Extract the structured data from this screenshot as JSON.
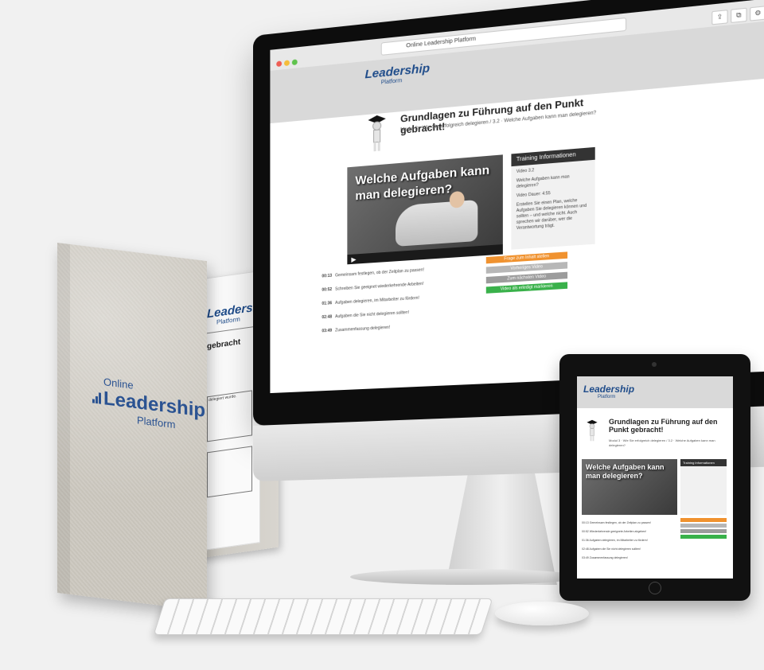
{
  "brand": {
    "line1": "Online",
    "line2": "Leadership",
    "line3": "Platform"
  },
  "folder": {
    "sheet_brand": "Leadership",
    "sheet_sub": "Platform",
    "sheet_title": "gebracht",
    "sheet_small": "delegiert wurde."
  },
  "browser": {
    "address": "Online Leadership Platform",
    "buttons": [
      "⇪",
      "⧉",
      "⚙"
    ]
  },
  "site": {
    "logo": "Leadership",
    "logo_sub": "Platform",
    "course_title": "Grundlagen zu Führung auf den Punkt gebracht!",
    "breadcrumb": "Modul 3  ·  Wie Sie erfolgreich delegieren  /  3.2  ·  Welche Aufgaben kann man delegieren?",
    "video_title": "Welche Aufgaben kann man delegieren?",
    "training_header": "Training Informationen",
    "training_lines": [
      "Video 3.2",
      "Welche Aufgaben kann man delegieren?",
      "Video Dauer: 4:55",
      "Erstellen Sie einen Plan, welche Aufgaben Sie delegieren können und sollten – und welche nicht. Auch sprechen wir darüber, wer die Verantwortung trägt."
    ],
    "buttons": [
      {
        "label": "Frage zum Inhalt stellen",
        "color": "#f0922f"
      },
      {
        "label": "Vorheriges Video",
        "color": "#b7b7b7"
      },
      {
        "label": "Zum nächsten Video",
        "color": "#9c9c9c"
      },
      {
        "label": "Video als erledigt markieren",
        "color": "#39b14a"
      }
    ],
    "chapters": [
      {
        "time": "00:13",
        "text": "Gemeinsam festlegen, ob der Zeitplan zu passen!"
      },
      {
        "time": "00:52",
        "text": "Schreiben Sie geeignet wiederkehrende Arbeiten!"
      },
      {
        "time": "01:36",
        "text": "Aufgaben delegieren, im Mitarbeiter zu fördern!"
      },
      {
        "time": "02:48",
        "text": "Aufgaben die Sie nicht delegieren sollten!"
      },
      {
        "time": "03:49",
        "text": "Zusammenfassung delegieren!"
      }
    ]
  },
  "tablet": {
    "logo": "Leadership",
    "logo_sub": "Platform",
    "course_title": "Grundlagen zu Führung auf den Punkt gebracht!",
    "breadcrumb": "Modul 3  ·  Wie Sie erfolgreich delegieren  /  3.2  ·  Welche Aufgaben kann man delegieren?",
    "video_title": "Welche Aufgaben kann man delegieren?",
    "training_header": "Training Informationen",
    "chapters": [
      "00:13  Gemeinsam festlegen, ob der Zeitplan zu passen!",
      "00:52  Wiederkehrende geeignete Arbeiten abgeben!",
      "01:36  Aufgaben delegieren, im Mitarbeiter zu fördern!",
      "02:48  Aufgaben die Sie nicht delegieren sollten!",
      "03:49  Zusammenfassung delegieren!"
    ]
  },
  "colors": {
    "brand_blue": "#1f4c8a",
    "accent_orange": "#f0922f",
    "accent_green": "#39b14a"
  }
}
